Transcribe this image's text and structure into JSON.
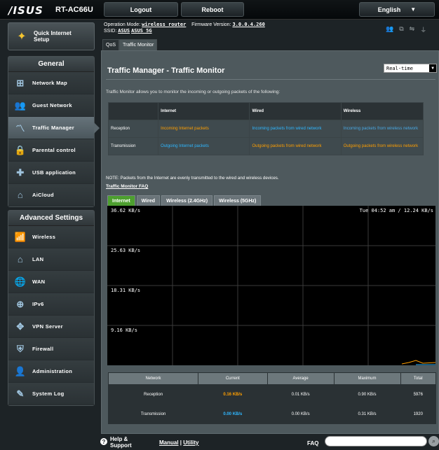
{
  "header": {
    "brand": "/ISUS",
    "model": "RT-AC66U",
    "logout": "Logout",
    "reboot": "Reboot",
    "language": "English",
    "op_mode_label": "Operation Mode:",
    "op_mode_value": "wireless router",
    "firmware_label": "Firmware Version:",
    "firmware_value": "3.0.0.4.260",
    "ssid_label": "SSID:",
    "ssid_1": "ASUS",
    "ssid_2": "ASUS_5G"
  },
  "subtabs": [
    "QoS",
    "Traffic Monitor"
  ],
  "sidebar": {
    "qis_line1": "Quick Internet",
    "qis_line2": "Setup",
    "general_title": "General",
    "general_items": [
      {
        "label": "Network Map",
        "icon": "network-map-icon"
      },
      {
        "label": "Guest Network",
        "icon": "guest-network-icon"
      },
      {
        "label": "Traffic Manager",
        "icon": "traffic-manager-icon"
      },
      {
        "label": "Parental control",
        "icon": "lock-icon"
      },
      {
        "label": "USB application",
        "icon": "puzzle-icon"
      },
      {
        "label": "AiCloud",
        "icon": "cloud-house-icon"
      }
    ],
    "advanced_title": "Advanced Settings",
    "advanced_items": [
      {
        "label": "Wireless",
        "icon": "wifi-icon"
      },
      {
        "label": "LAN",
        "icon": "house-icon"
      },
      {
        "label": "WAN",
        "icon": "globe-icon"
      },
      {
        "label": "IPv6",
        "icon": "globe-ipv6-icon"
      },
      {
        "label": "VPN Server",
        "icon": "vpn-icon"
      },
      {
        "label": "Firewall",
        "icon": "shield-icon"
      },
      {
        "label": "Administration",
        "icon": "admin-icon"
      },
      {
        "label": "System Log",
        "icon": "system-log-icon"
      }
    ]
  },
  "main": {
    "title": "Traffic Manager - Traffic Monitor",
    "view_select": "Real-time",
    "description": "Traffic Monitor allows you to monitor the incoming or outgoing packets of the following:",
    "table_headers": [
      "",
      "Internet",
      "Wired",
      "Wireless"
    ],
    "rows": [
      {
        "label": "Reception",
        "internet": "Incoming Internet packets",
        "wired": "Incoming packets from wired network",
        "wireless": "Incoming packets from wireless network"
      },
      {
        "label": "Transmission",
        "internet": "Outgoing Internet packets",
        "wired": "Outgoing packets from wired network",
        "wireless": "Outgoing packets from wireless network"
      }
    ],
    "note": "NOTE: Packets from the Internet are evenly transmitted to the wired and wireless devices.",
    "faq_link": "Traffic Monitor FAQ",
    "chart_tabs": [
      "Internet",
      "Wired",
      "Wireless (2.4GHz)",
      "Wireless (5GHz)"
    ],
    "chart_y_labels": [
      "36.62 KB/s",
      "25.63 KB/s",
      "18.31 KB/s",
      "9.16 KB/s"
    ],
    "chart_timestamp": "Tue 04:52 am / 12.24 KB/s",
    "stats_headers": [
      "Network",
      "Current",
      "Average",
      "Maximum",
      "Total"
    ],
    "stats_rows": [
      {
        "network": "Reception",
        "current": "0.16 KB/s",
        "average": "0.01 KB/s",
        "maximum": "0.90 KB/s",
        "total": "5976"
      },
      {
        "network": "Transmission",
        "current": "0.00 KB/s",
        "average": "0.00 KB/s",
        "maximum": "0.31 KB/s",
        "total": "1920"
      }
    ]
  },
  "footer": {
    "help_line1": "Help &",
    "help_line2": "Support",
    "manual": "Manual",
    "separator": "|",
    "utility": "Utility",
    "faq": "FAQ"
  }
}
